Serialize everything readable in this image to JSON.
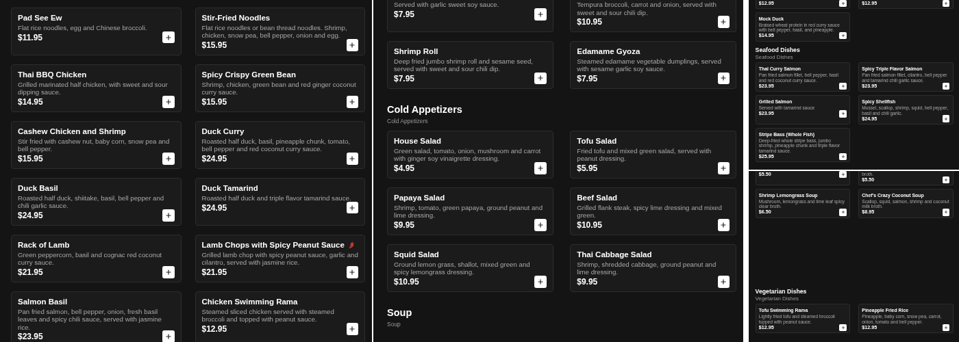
{
  "panels": [
    {
      "sections": [
        {
          "items": [
            {
              "name": "Pad See Ew",
              "description": "Flat rice noodles, egg and Chinese broccoli.",
              "price": "$11.95",
              "spicy": false
            },
            {
              "name": "Stir-Fried Noodles",
              "description": "Flat rice noodles or bean thread noodles. Shrimp, chicken, snow pea, bell pepper, onion and egg.",
              "price": "$15.95",
              "spicy": false
            },
            {
              "name": "Thai BBQ Chicken",
              "description": "Grilled marinated half chicken, with sweet and sour dipping sauce.",
              "price": "$14.95",
              "spicy": false
            },
            {
              "name": "Spicy Crispy Green Bean",
              "description": "Shrimp, chicken, green bean and red ginger coconut curry sauce.",
              "price": "$15.95",
              "spicy": false
            },
            {
              "name": "Cashew Chicken and Shrimp",
              "description": "Stir fried with cashew nut, baby corn, snow pea and bell pepper.",
              "price": "$15.95",
              "spicy": false
            },
            {
              "name": "Duck Curry",
              "description": "Roasted half duck, basil, pineapple chunk, tomato, bell pepper and red coconut curry sauce.",
              "price": "$24.95",
              "spicy": false
            },
            {
              "name": "Duck Basil",
              "description": "Roasted half duck, shiitake, basil, bell pepper and chili garlic sauce.",
              "price": "$24.95",
              "spicy": false
            },
            {
              "name": "Duck Tamarind",
              "description": "Roasted half duck and triple flavor tamarind sauce.",
              "price": "$24.95",
              "spicy": false
            },
            {
              "name": "Rack of Lamb",
              "description": "Green peppercorn, basil and cognac red coconut curry sauce.",
              "price": "$21.95",
              "spicy": false
            },
            {
              "name": "Lamb Chops with Spicy Peanut Sauce",
              "description": "Grilled lamb chop with spicy peanut sauce, garlic and cilantro, served with jasmine rice.",
              "price": "$21.95",
              "spicy": true
            },
            {
              "name": "Salmon Basil",
              "description": "Pan fried salmon, bell pepper, onion, fresh basil leaves and spicy chili sauce, served with jasmine rice.",
              "price": "$23.95",
              "spicy": false
            },
            {
              "name": "Chicken Swimming Rama",
              "description": "Steamed sliced chicken served with steamed broccoli and topped with peanut sauce.",
              "price": "$12.95",
              "spicy": false
            }
          ]
        }
      ]
    },
    {
      "sections": [
        {
          "items": [
            {
              "description": "Served with garlic sweet soy sauce.",
              "price": "$7.95",
              "spicy": false
            },
            {
              "description": "Tempura broccoli, carrot and onion, served with sweet and sour chili dip.",
              "price": "$10.95",
              "spicy": false
            },
            {
              "name": "Shrimp Roll",
              "description": "Deep fried jumbo shrimp roll and sesame seed, served with sweet and sour chili dip.",
              "price": "$7.95",
              "spicy": false
            },
            {
              "name": "Edamame Gyoza",
              "description": "Steamed edamame vegetable dumplings, served with sesame garlic soy sauce.",
              "price": "$7.95",
              "spicy": false
            }
          ]
        },
        {
          "heading": "Cold Appetizers",
          "subheading": "Cold Appetizers",
          "items": [
            {
              "name": "House Salad",
              "description": "Green salad, tomato, onion, mushroom and carrot with ginger soy vinaigrette dressing.",
              "price": "$4.95",
              "spicy": false
            },
            {
              "name": "Tofu Salad",
              "description": "Fried tofu and mixed green salad, served with peanut dressing.",
              "price": "$5.95",
              "spicy": false
            },
            {
              "name": "Papaya Salad",
              "description": "Shrimp, tomato, green papaya, ground peanut and lime dressing.",
              "price": "$9.95",
              "spicy": false
            },
            {
              "name": "Beef Salad",
              "description": "Grilled flank steak, spicy lime dressing and mixed green.",
              "price": "$10.95",
              "spicy": false
            },
            {
              "name": "Squid Salad",
              "description": "Ground lemon grass, shallot, mixed green and spicy lemongrass dressing.",
              "price": "$10.95",
              "spicy": false
            },
            {
              "name": "Thai Cabbage Salad",
              "description": "Shrimp, shredded cabbage, ground peanut and lime dressing.",
              "price": "$9.95",
              "spicy": false
            }
          ]
        },
        {
          "heading": "Soup",
          "subheading": "Soup"
        }
      ]
    },
    {
      "sections": [
        {
          "items": [
            {
              "price": "$12.95",
              "spicy": false
            },
            {
              "price": "$12.95",
              "spicy": false
            },
            {
              "name": "Mock Duck",
              "description": "Braised wheat protein in red curry sauce with bell pepper, basil, and pineapple.",
              "price": "$14.95",
              "spicy": false
            }
          ]
        },
        {
          "heading": "Seafood Dishes",
          "subheading": "Seafood Dishes",
          "items": [
            {
              "name": "Thai Curry Salmon",
              "description": "Pan fried salmon fillet, bell pepper, basil and red coconut curry sauce.",
              "price": "$23.95",
              "spicy": false
            },
            {
              "name": "Spicy Triple Flavor Salmon",
              "description": "Pan fried salmon fillet, cilantro, bell pepper and tamarind chili garlic sauce.",
              "price": "$23.95",
              "spicy": false
            },
            {
              "name": "Grilled Salmon",
              "description": "Served with tamarind sauce",
              "price": "$23.95",
              "spicy": false
            },
            {
              "name": "Spicy Shellfish",
              "description": "Mussel, scallop, shrimp, squid, bell pepper, basil and chili garlic.",
              "price": "$24.95",
              "spicy": false
            },
            {
              "name": "Stripe Bass (Whole Fish)",
              "description": "Deep-fried whole stripe bass, jumbo shrimp, pineapple chunk and triple flavor tamarind sauce.",
              "price": "$25.95",
              "spicy": false
            }
          ]
        }
      ]
    },
    {
      "sections": [
        {
          "items": [
            {
              "price": "$5.50",
              "spicy": false
            },
            {
              "description": "broth.",
              "price": "$5.50",
              "spicy": false
            },
            {
              "name": "Shrimp Lemongrass Soup",
              "description": "Mushroom, lemongrass and lime leaf spicy clear broth.",
              "price": "$6.50",
              "spicy": false
            },
            {
              "name": "Chef's Crazy Coconut Soup",
              "description": "Scallop, squid, salmon, shrimp and coconut milk broth.",
              "price": "$8.95",
              "spicy": false
            }
          ]
        },
        {
          "heading": "Vegetarian Dishes",
          "subheading": "Vegetarian Dishes",
          "items": [
            {
              "name": "Tofu Swimming Rama",
              "description": "Lightly fried tofu and steamed broccoli topped with peanut sauce.",
              "price": "$12.95",
              "spicy": false
            },
            {
              "name": "Pineapple Fried Rice",
              "description": "Pineapple, baby corn, snow pea, carrot, onion, tomato and bell pepper.",
              "price": "$12.95",
              "spicy": false
            }
          ]
        }
      ]
    }
  ]
}
